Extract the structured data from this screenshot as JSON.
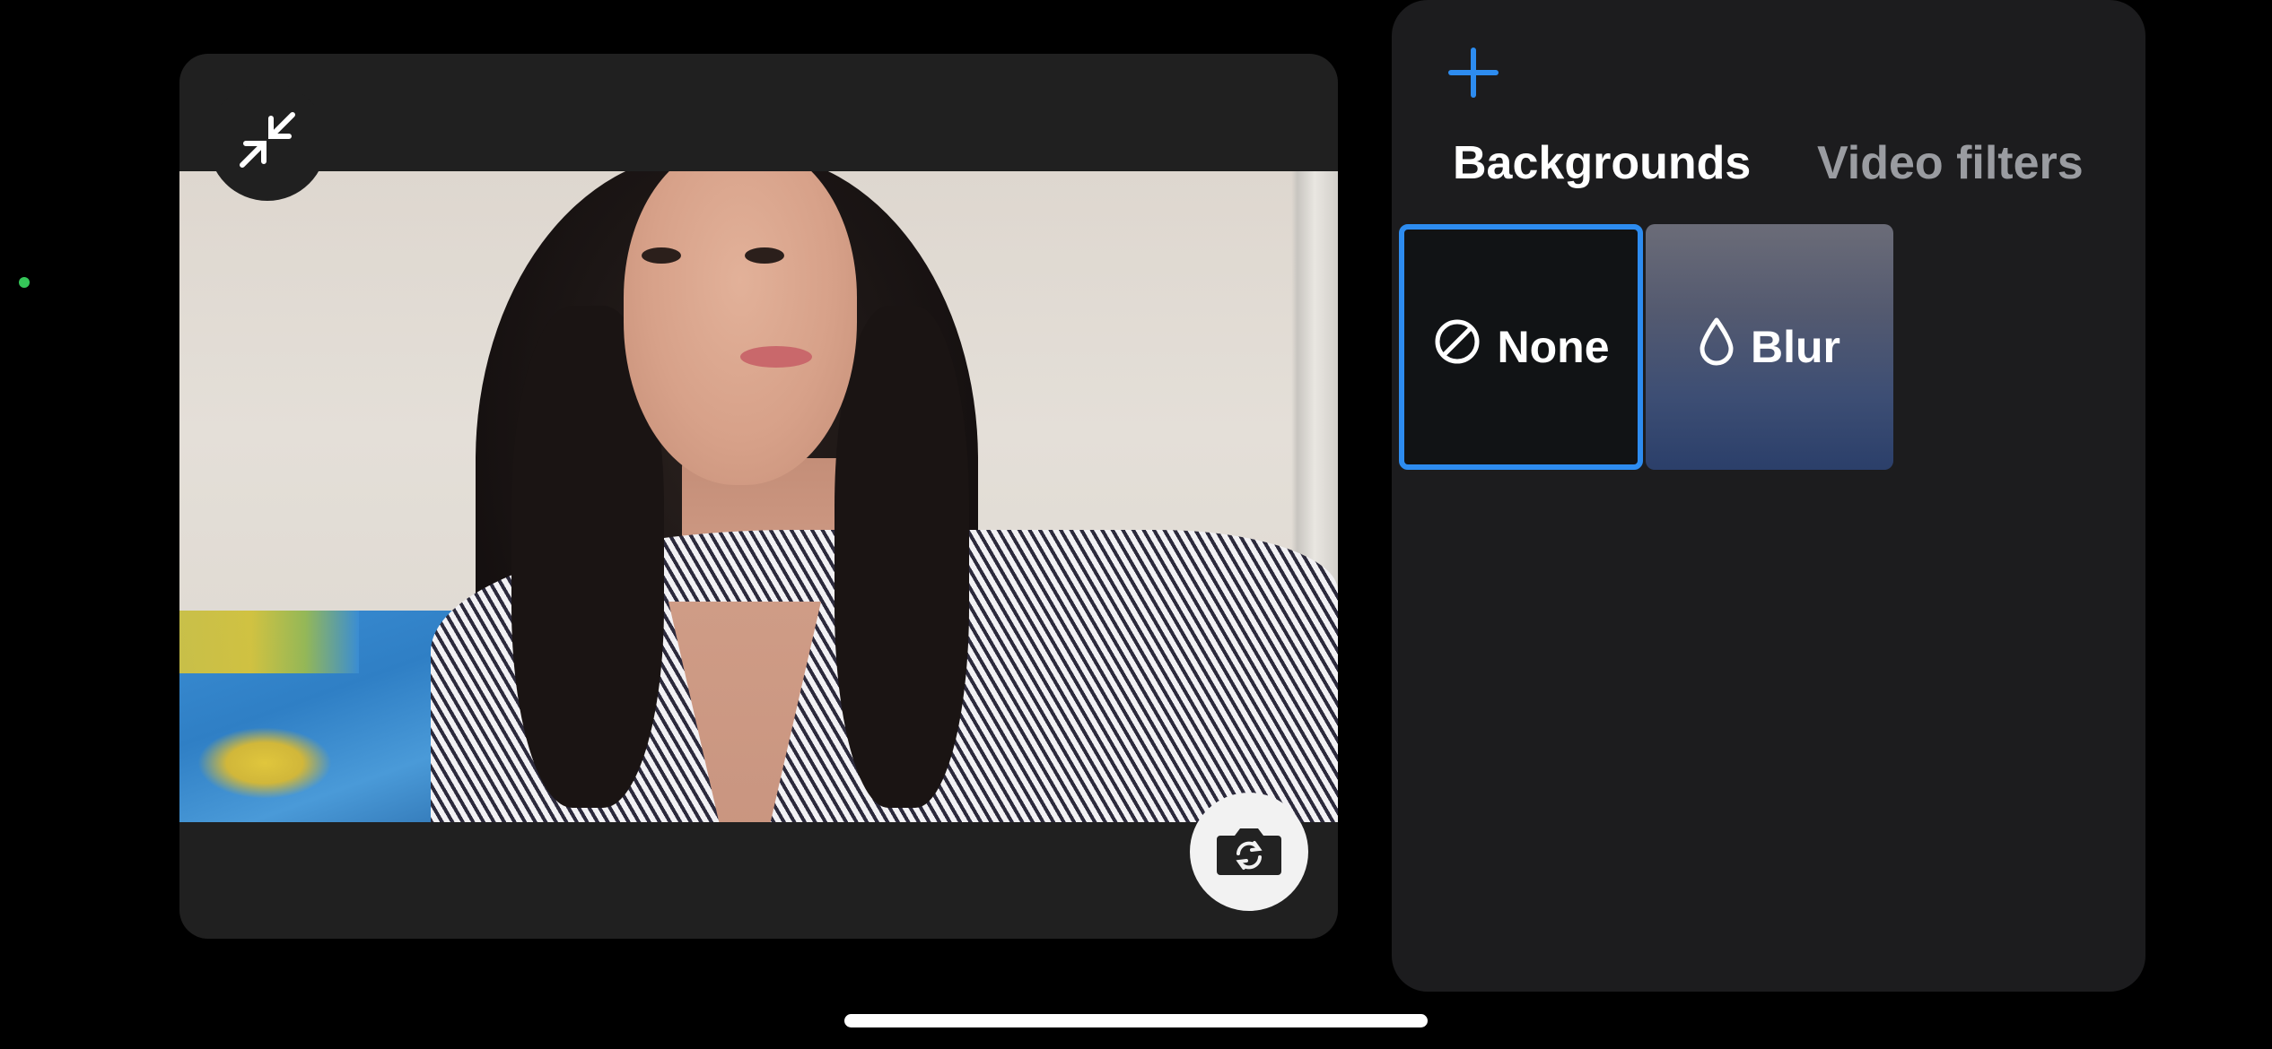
{
  "video": {
    "minimize_icon": "arrows-inward-icon",
    "flip_camera_icon": "camera-rotate-icon"
  },
  "effects": {
    "add_icon": "plus-icon",
    "accent_color": "#2d8cf0",
    "tabs": [
      {
        "label": "Backgrounds",
        "selected": true
      },
      {
        "label": "Video filters",
        "selected": false
      }
    ],
    "options": [
      {
        "label": "None",
        "icon": "prohibited-icon",
        "selected": true
      },
      {
        "label": "Blur",
        "icon": "droplet-icon",
        "selected": false
      }
    ]
  }
}
